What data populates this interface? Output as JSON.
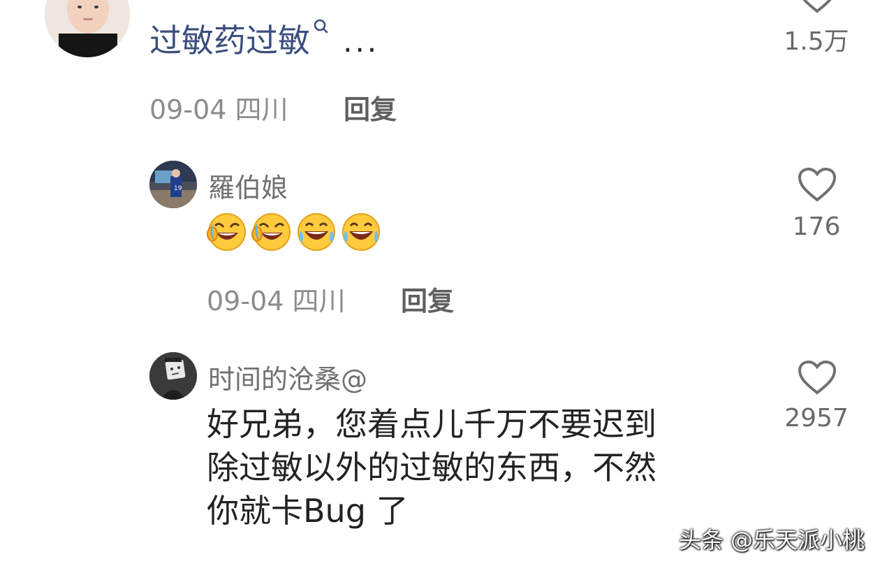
{
  "comment_top": {
    "text": "过敏药过敏",
    "ellipsis": "...",
    "date": "09-04 四川",
    "reply_label": "回复",
    "likes": "1.5万"
  },
  "reply_1": {
    "username": "羅伯娘",
    "emojis": [
      "laugh-cry-emoji",
      "laugh-cry-emoji",
      "tears-of-joy-emoji",
      "tears-of-joy-emoji"
    ],
    "date": "09-04 四川",
    "reply_label": "回复",
    "likes": "176"
  },
  "reply_2": {
    "username": "时间的沧桑@",
    "line1": "好兄弟，您着点儿千万不要迟到",
    "line2": "除过敏以外的过敏的东西，不然",
    "line3": "你就卡Bug 了",
    "likes": "2957"
  },
  "watermark": "头条 @乐天派小桃",
  "colors": {
    "link": "#3b4f7d",
    "meta": "#8c8c8c",
    "heart_stroke": "#707070"
  }
}
